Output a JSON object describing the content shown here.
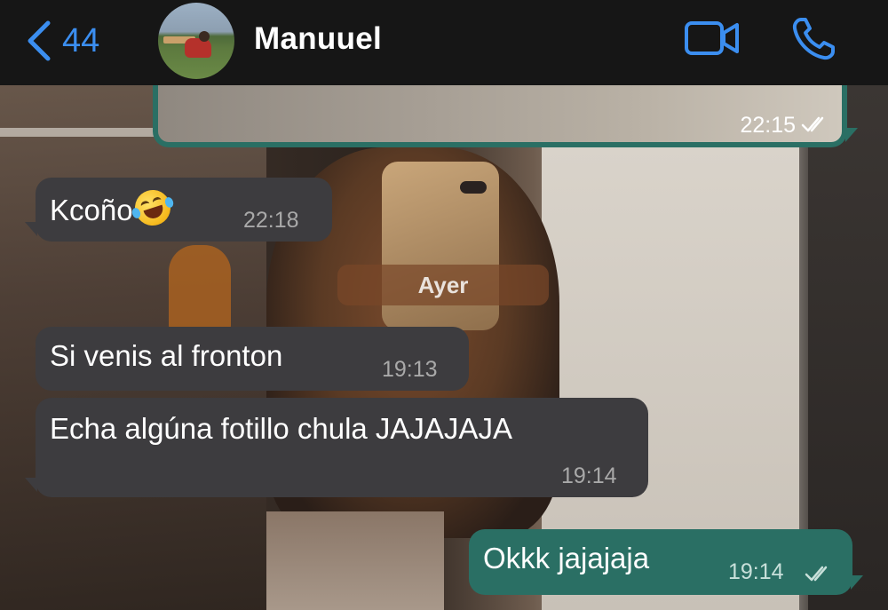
{
  "header": {
    "back_count": "44",
    "contact_name": "Manuuel",
    "icons": {
      "back": "chevron-left-icon",
      "video": "video-camera-icon",
      "call": "phone-icon"
    },
    "accent_color": "#3b8ef0"
  },
  "chat": {
    "messages": [
      {
        "direction": "outgoing",
        "type": "image",
        "time": "22:15",
        "status": "read"
      },
      {
        "direction": "incoming",
        "text": "Kcoño",
        "emoji": "rolling-on-floor-laughing",
        "time": "22:18"
      },
      {
        "direction": "incoming",
        "text": "Si venis al fronton",
        "time": "19:13"
      },
      {
        "direction": "incoming",
        "text": "Echa algúna fotillo chula JAJAJAJA",
        "time": "19:14"
      },
      {
        "direction": "outgoing",
        "text": "Okkk jajajaja",
        "time": "19:14",
        "status": "read"
      }
    ],
    "date_separator": "Ayer",
    "colors": {
      "incoming_bubble": "#3d3c3f",
      "outgoing_bubble": "#2a6f64"
    }
  }
}
